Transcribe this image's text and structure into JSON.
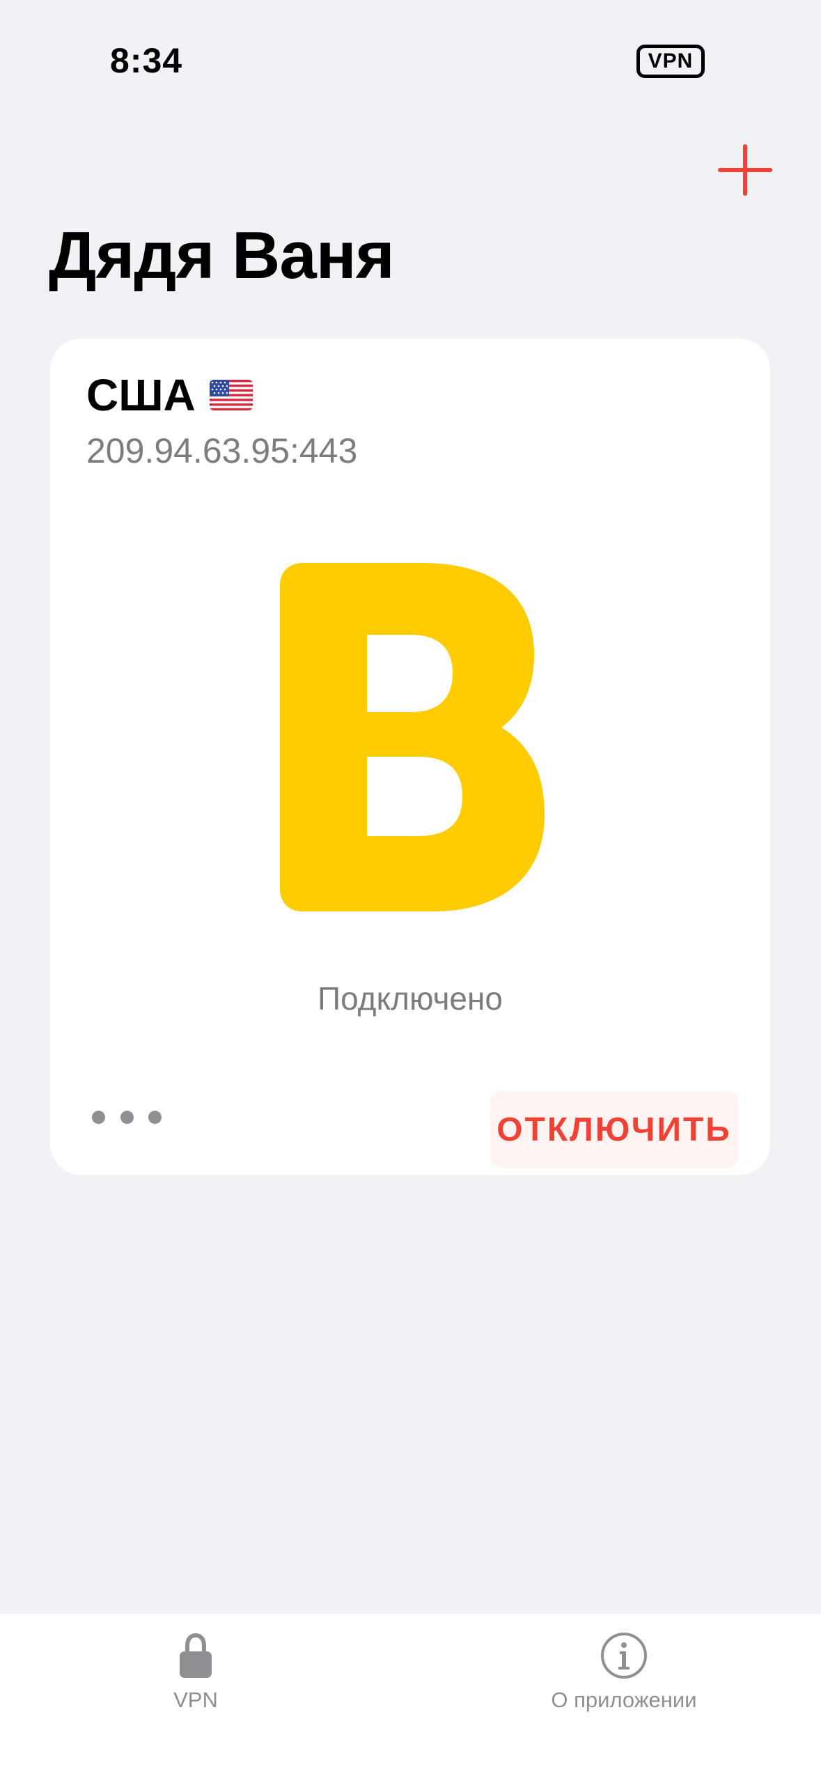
{
  "status_bar": {
    "time": "8:34",
    "vpn_badge": "VPN"
  },
  "header": {
    "add_icon": "plus-icon",
    "title": "Дядя Ваня"
  },
  "card": {
    "title": "США",
    "flag_icon": "us-flag-icon",
    "address": "209.94.63.95:443",
    "logo_icon": "yellow-letter-b-logo",
    "status": "Подключено",
    "more_icon": "ellipsis-icon",
    "disconnect_label": "ОТКЛЮЧИТЬ"
  },
  "tab_bar": {
    "tabs": [
      {
        "icon": "lock-icon",
        "label": "VPN"
      },
      {
        "icon": "info-icon",
        "label": "О приложении"
      }
    ]
  },
  "colors": {
    "background": "#f2f1f6",
    "accent_red": "#f04135",
    "logo_yellow": "#ffcc00",
    "secondary_text": "#7c7c80",
    "tab_inactive": "#8e8e93"
  }
}
